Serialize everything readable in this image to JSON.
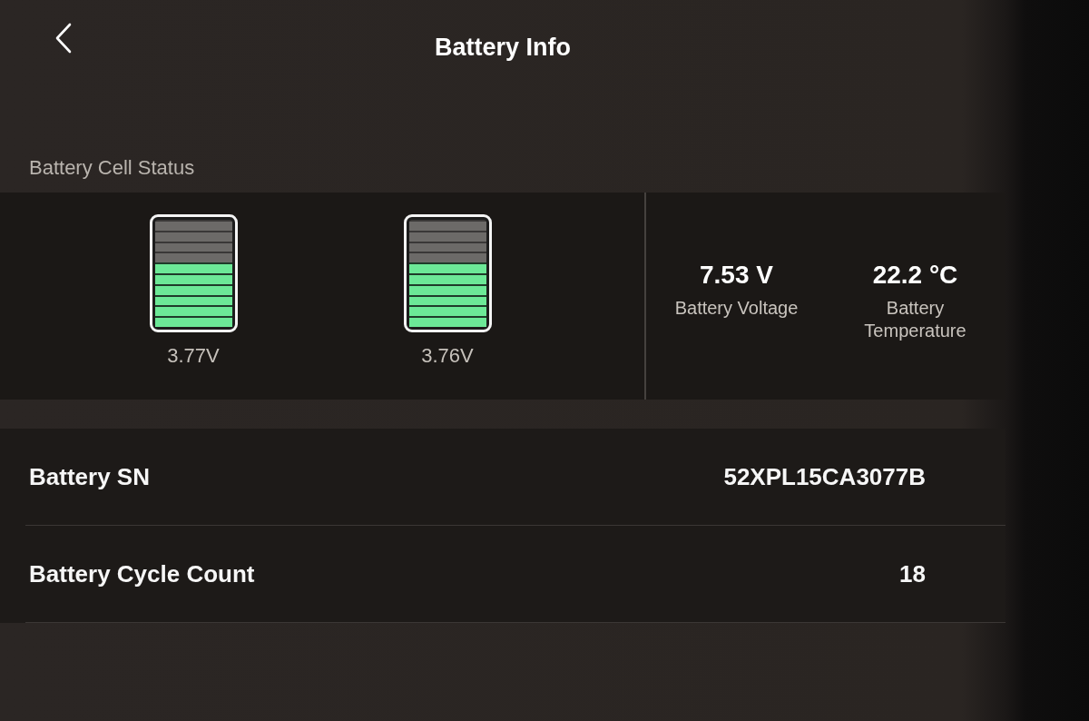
{
  "header": {
    "title": "Battery Info"
  },
  "cell_status": {
    "label": "Battery Cell Status",
    "cells": [
      {
        "level": 0.6,
        "reading": "3.77V"
      },
      {
        "level": 0.6,
        "reading": "3.76V"
      }
    ],
    "stats": [
      {
        "value": "7.53 V",
        "label": "Battery Voltage"
      },
      {
        "value": "22.2 °C",
        "label": "Battery Temperature"
      }
    ]
  },
  "info_rows": [
    {
      "label": "Battery SN",
      "value": "52XPL15CA3077B"
    },
    {
      "label": "Battery Cycle Count",
      "value": "18"
    }
  ]
}
